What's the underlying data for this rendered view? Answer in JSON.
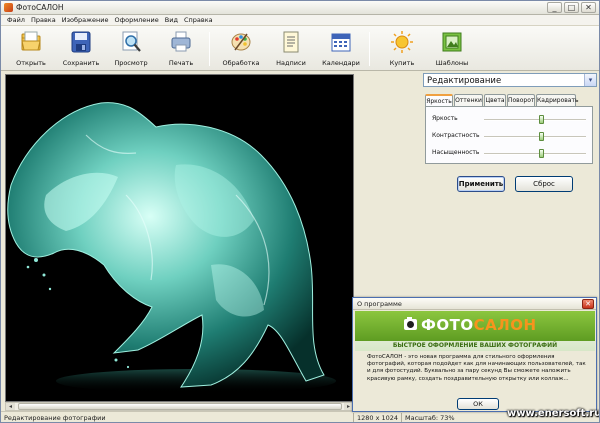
{
  "window": {
    "title": "ФотоСАЛОН"
  },
  "menu": [
    "Файл",
    "Правка",
    "Изображение",
    "Оформление",
    "Вид",
    "Справка"
  ],
  "toolbar": {
    "open": "Открыть",
    "save": "Сохранить",
    "preview": "Просмотр",
    "print": "Печать",
    "processing": "Обработка",
    "captions": "Надписи",
    "calendars": "Календари",
    "buy": "Купить",
    "templates": "Шаблоны"
  },
  "panel": {
    "mode": "Редактирование",
    "tabs": [
      "Яркость",
      "Оттенки",
      "Цвета",
      "Поворот",
      "Кадрировать"
    ],
    "sliders": [
      {
        "label": "Яркость",
        "value": 0.57
      },
      {
        "label": "Контрастность",
        "value": 0.57
      },
      {
        "label": "Насыщенность",
        "value": 0.57
      }
    ],
    "apply": "Применить",
    "reset": "Сброс"
  },
  "status": {
    "mode": "Редактирование фотографии",
    "size": "1280 x 1024",
    "zoom": "Масштаб: 73%"
  },
  "dialog": {
    "title": "О программе",
    "logo_white": "ФОТО",
    "logo_orange": "САЛОН",
    "slogan": "БЫСТРОЕ ОФОРМЛЕНИЕ ВАШИХ ФОТОГРАФИЙ",
    "body": "ФотоСАЛОН - это новая программа для стильного оформления фотографий, которая подойдет как для начинающих пользователей, так и для фотостудий. Буквально за пару секунд Вы сможете наложить красивую рамку, создать поздравительную открытку или коллаж...",
    "ok": "ОК"
  },
  "watermark": "www.enersoft.ru",
  "colors": {
    "accent_green": "#7ab833",
    "accent_orange": "#f7941d",
    "title_blue": "#4b6eaf"
  }
}
